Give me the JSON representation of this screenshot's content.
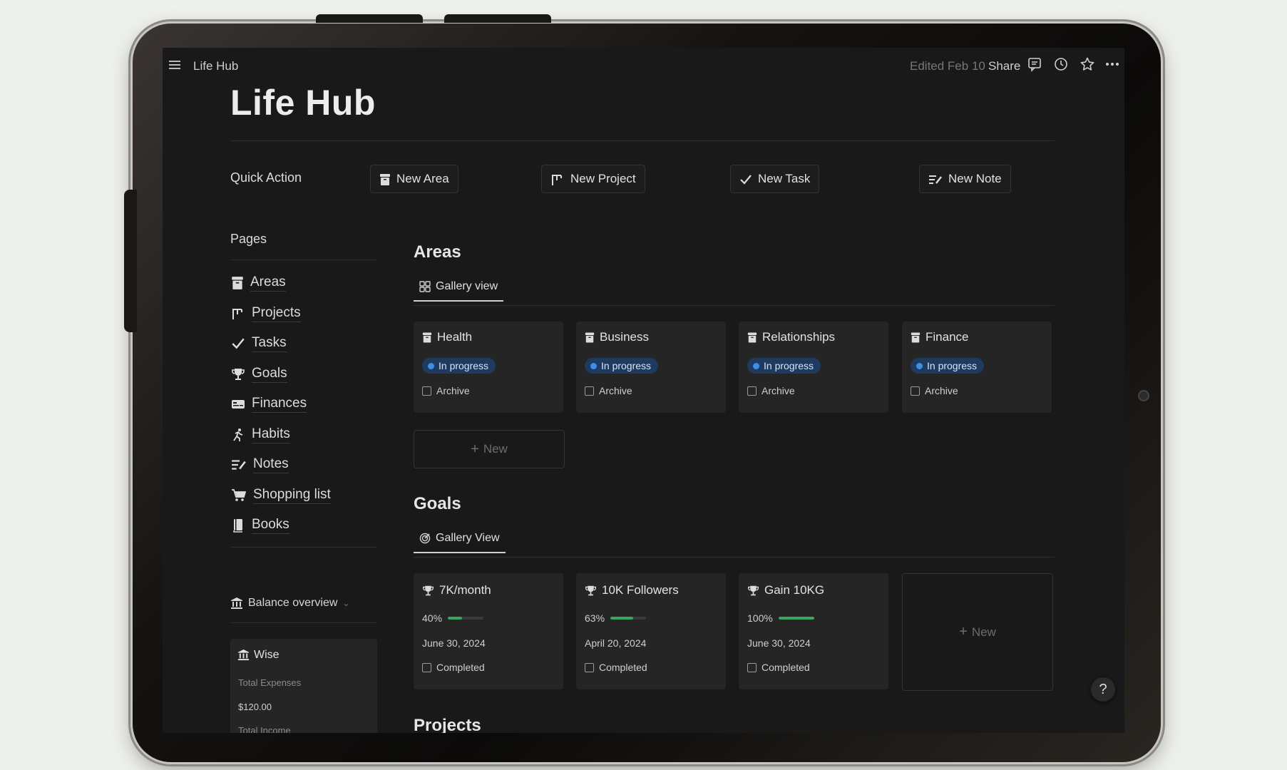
{
  "topbar": {
    "page_name": "Life Hub",
    "edited": "Edited Feb 10",
    "share": "Share"
  },
  "title": "Life Hub",
  "quick_action": {
    "label": "Quick Action",
    "buttons": [
      {
        "label": "New Area",
        "icon": "archive-icon"
      },
      {
        "label": "New Project",
        "icon": "project-icon"
      },
      {
        "label": "New Task",
        "icon": "check-icon"
      },
      {
        "label": "New Note",
        "icon": "note-icon"
      }
    ]
  },
  "pages": {
    "heading": "Pages",
    "items": [
      {
        "label": "Areas",
        "icon": "archive-icon"
      },
      {
        "label": "Projects",
        "icon": "project-icon"
      },
      {
        "label": "Tasks",
        "icon": "check-icon"
      },
      {
        "label": "Goals",
        "icon": "trophy-icon"
      },
      {
        "label": "Finances",
        "icon": "money-icon"
      },
      {
        "label": "Habits",
        "icon": "running-icon"
      },
      {
        "label": "Notes",
        "icon": "note-icon"
      },
      {
        "label": "Shopping list",
        "icon": "cart-icon"
      },
      {
        "label": "Books",
        "icon": "book-icon"
      }
    ]
  },
  "balance": {
    "label": "Balance overview",
    "account": {
      "name": "Wise",
      "expenses_label": "Total Expenses",
      "expenses_value": "$120.00",
      "income_label": "Total Income"
    }
  },
  "areas": {
    "title": "Areas",
    "view_label": "Gallery view",
    "cards": [
      {
        "name": "Health",
        "status": "In progress",
        "archive": "Archive"
      },
      {
        "name": "Business",
        "status": "In progress",
        "archive": "Archive"
      },
      {
        "name": "Relationships",
        "status": "In progress",
        "archive": "Archive"
      },
      {
        "name": "Finance",
        "status": "In progress",
        "archive": "Archive"
      }
    ],
    "new_label": "New"
  },
  "goals": {
    "title": "Goals",
    "view_label": "Gallery View",
    "cards": [
      {
        "name": "7K/month",
        "progress_text": "40%",
        "progress": 0.4,
        "date": "June 30, 2024",
        "completed": "Completed"
      },
      {
        "name": "10K Followers",
        "progress_text": "63%",
        "progress": 0.63,
        "date": "April 20, 2024",
        "completed": "Completed"
      },
      {
        "name": "Gain 10KG",
        "progress_text": "100%",
        "progress": 1.0,
        "date": "June 30, 2024",
        "completed": "Completed"
      }
    ],
    "new_label": "New"
  },
  "projects": {
    "title": "Projects"
  },
  "help": "?",
  "colors": {
    "background": "#191919",
    "badge_bg": "#1e3a5f",
    "badge_dot": "#3e8ee8",
    "progress_fill": "#3aa55d"
  }
}
